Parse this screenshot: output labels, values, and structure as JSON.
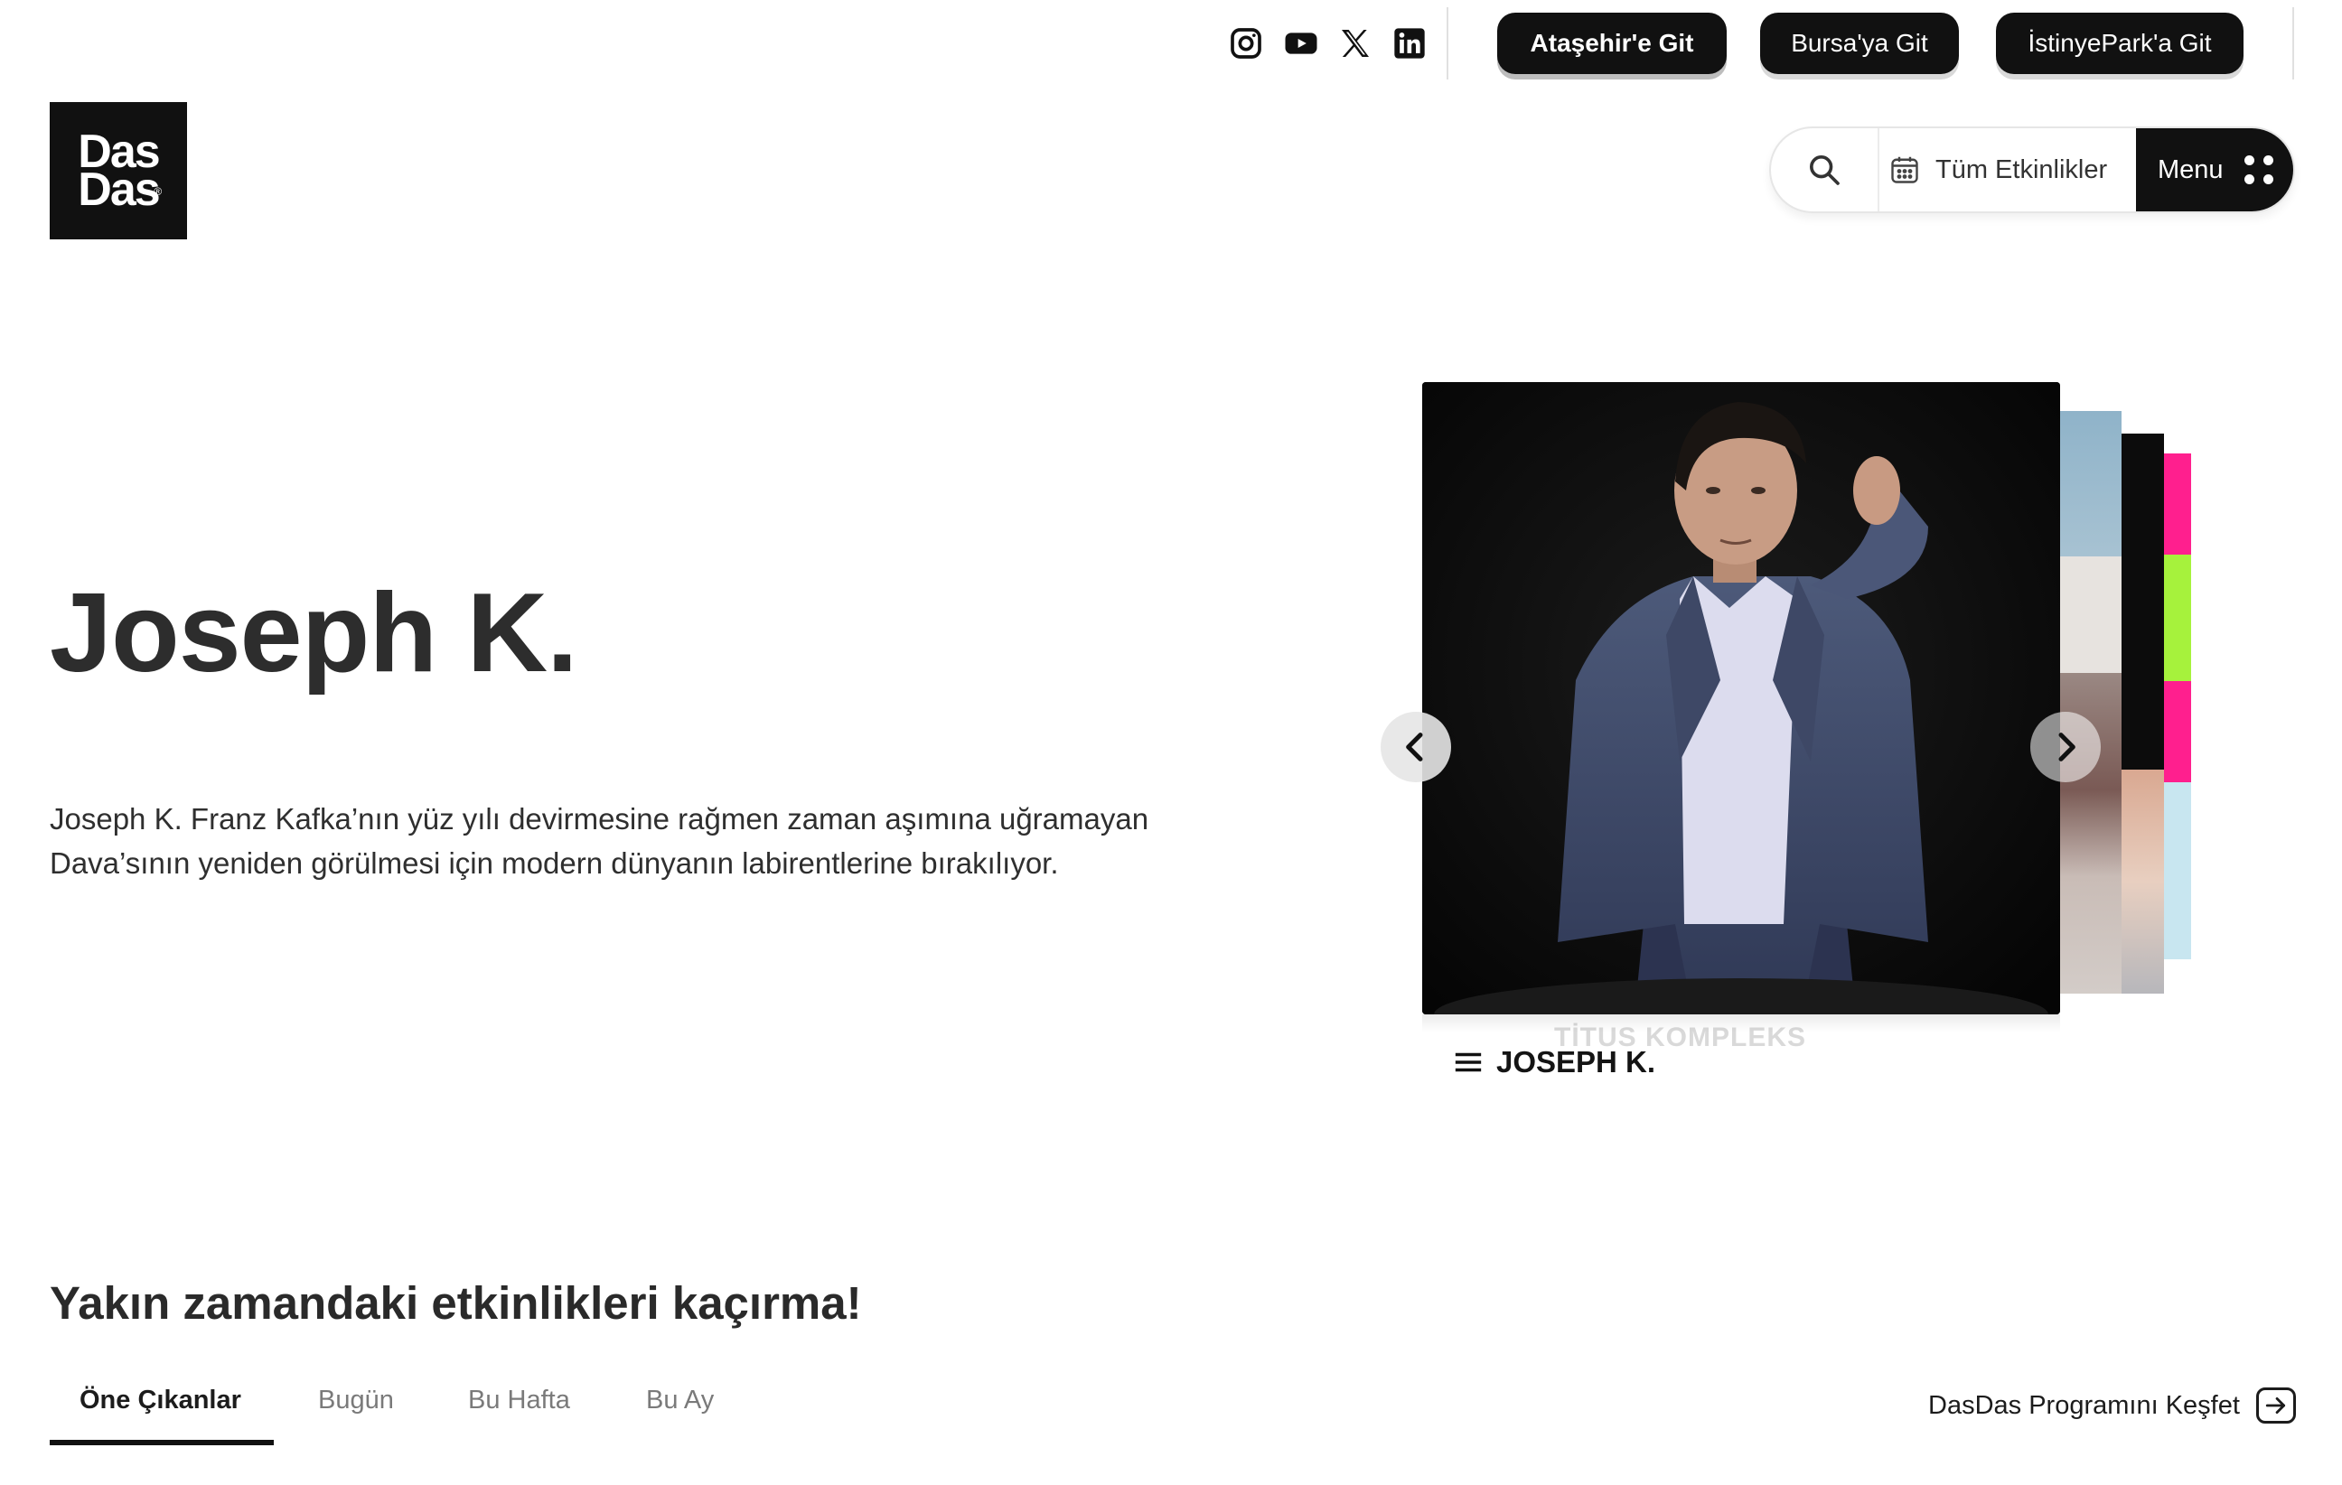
{
  "header": {
    "social": [
      {
        "name": "instagram",
        "icon": "instagram-icon"
      },
      {
        "name": "youtube",
        "icon": "youtube-icon"
      },
      {
        "name": "x",
        "icon": "x-icon"
      },
      {
        "name": "linkedin",
        "icon": "linkedin-icon"
      }
    ],
    "locations": [
      {
        "label": "Ataşehir'e Git",
        "active": true
      },
      {
        "label": "Bursa'ya Git",
        "active": false
      },
      {
        "label": "İstinyePark'a Git",
        "active": false
      }
    ]
  },
  "logo": {
    "line1": "Das",
    "line2": "Das",
    "reg": "®"
  },
  "nav": {
    "events_label": "Tüm Etkinlikler",
    "menu_label": "Menu"
  },
  "hero": {
    "title": "Joseph K.",
    "description": "Joseph K. Franz Kafka’nın yüz yılı devirmesine rağmen zaman aşımına uğramayan Dava’sının yeniden görülmesi için modern dünyanın labirentlerine bırakılıyor."
  },
  "carousel": {
    "current_caption": "JOSEPH K.",
    "next_caption": "TİTUS KOMPLEKS"
  },
  "upcoming": {
    "title": "Yakın zamandaki etkinlikleri kaçırma!",
    "tabs": [
      "Öne Çıkanlar",
      "Bugün",
      "Bu Hafta",
      "Bu Ay"
    ],
    "active_tab": 0,
    "explore_label": "DasDas Programını Keşfet"
  },
  "colors": {
    "primary": "#111111",
    "background": "#ffffff",
    "text": "#2b2b2b",
    "muted": "#7a7a7a"
  }
}
